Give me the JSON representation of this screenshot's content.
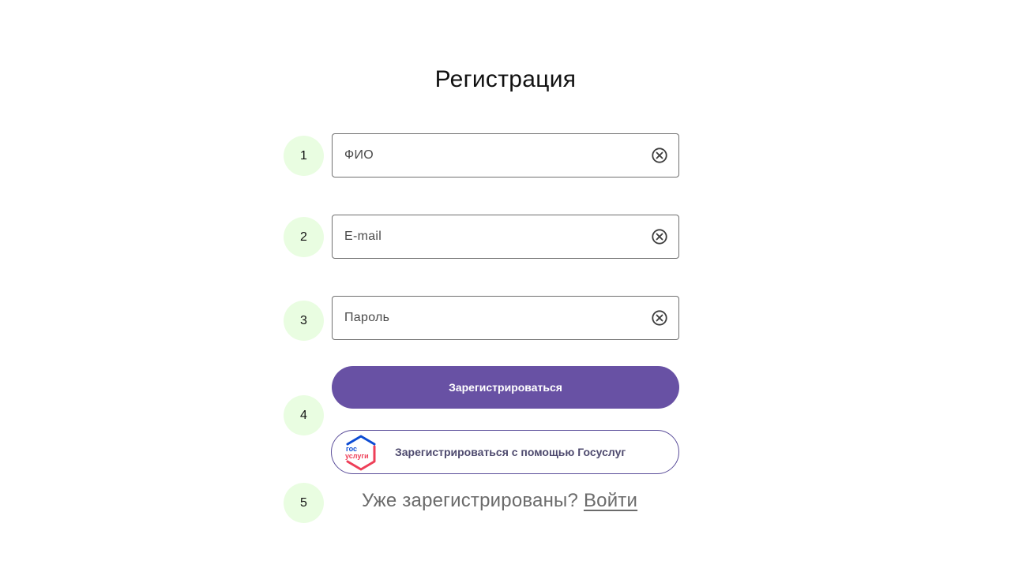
{
  "title": "Регистрация",
  "steps": [
    "1",
    "2",
    "3",
    "4",
    "5"
  ],
  "fields": {
    "fio": {
      "placeholder": "ФИО",
      "value": ""
    },
    "email": {
      "placeholder": "E-mail",
      "value": ""
    },
    "password": {
      "placeholder": "Пароль",
      "value": ""
    }
  },
  "register_button": "Зарегистрироваться",
  "gosuslugi_button": {
    "label": "Зарегистрироваться с помощью Госуслуг",
    "logo_text_top": "гос",
    "logo_text_bottom": "услуги"
  },
  "login": {
    "prompt": "Уже зарегистрированы?",
    "link": "Войти"
  },
  "colors": {
    "accent": "#6851a4",
    "step_bg": "#e9fde1",
    "gos_blue": "#0d4cd3",
    "gos_red": "#ee3f58"
  },
  "icons": {
    "clear": "close-circle-icon",
    "gosuslugi": "gosuslugi-logo"
  }
}
